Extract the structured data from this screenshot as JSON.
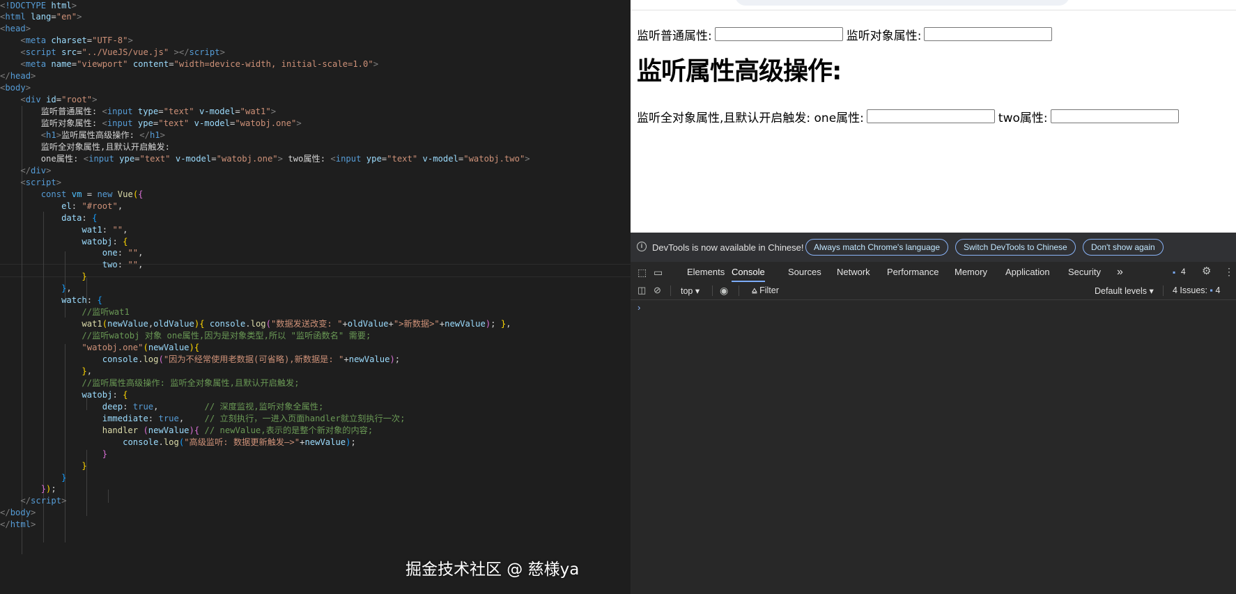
{
  "editor": {
    "lines": [
      [
        [
          "t-ang",
          "<"
        ],
        [
          "t-tag",
          "!DOCTYPE "
        ],
        [
          "t-attr",
          "html"
        ],
        [
          "t-ang",
          ">"
        ]
      ],
      [
        [
          "t-ang",
          "<"
        ],
        [
          "t-tag",
          "html "
        ],
        [
          "t-attr",
          "lang"
        ],
        [
          "t-pun",
          "="
        ],
        [
          "t-str",
          "\"en\""
        ],
        [
          "t-ang",
          ">"
        ]
      ],
      [
        [
          "t-ang",
          "<"
        ],
        [
          "t-tag",
          "head"
        ],
        [
          "t-ang",
          ">"
        ]
      ],
      [
        [
          "t-txt",
          "    "
        ],
        [
          "t-ang",
          "<"
        ],
        [
          "t-tag",
          "meta "
        ],
        [
          "t-attr",
          "charset"
        ],
        [
          "t-pun",
          "="
        ],
        [
          "t-str",
          "\"UTF-8\""
        ],
        [
          "t-ang",
          ">"
        ]
      ],
      [
        [
          "t-txt",
          "    "
        ],
        [
          "t-ang",
          "<"
        ],
        [
          "t-tag",
          "script "
        ],
        [
          "t-attr",
          "src"
        ],
        [
          "t-pun",
          "="
        ],
        [
          "t-str",
          "\"../VueJS/vue.js\""
        ],
        [
          "t-txt",
          " "
        ],
        [
          "t-ang",
          "></"
        ],
        [
          "t-tag",
          "script"
        ],
        [
          "t-ang",
          ">"
        ]
      ],
      [
        [
          "t-txt",
          "    "
        ],
        [
          "t-ang",
          "<"
        ],
        [
          "t-tag",
          "meta "
        ],
        [
          "t-attr",
          "name"
        ],
        [
          "t-pun",
          "="
        ],
        [
          "t-str",
          "\"viewport\""
        ],
        [
          "t-txt",
          " "
        ],
        [
          "t-attr",
          "content"
        ],
        [
          "t-pun",
          "="
        ],
        [
          "t-str",
          "\"width=device-width, initial-scale=1.0\""
        ],
        [
          "t-ang",
          ">"
        ]
      ],
      [
        [
          "t-ang",
          "</"
        ],
        [
          "t-tag",
          "head"
        ],
        [
          "t-ang",
          ">"
        ]
      ],
      [
        [
          "t-ang",
          "<"
        ],
        [
          "t-tag",
          "body"
        ],
        [
          "t-ang",
          ">"
        ]
      ],
      [
        [
          "t-txt",
          "    "
        ],
        [
          "t-ang",
          "<"
        ],
        [
          "t-tag",
          "div "
        ],
        [
          "t-attr",
          "id"
        ],
        [
          "t-pun",
          "="
        ],
        [
          "t-str",
          "\"root\""
        ],
        [
          "t-ang",
          ">"
        ]
      ],
      [
        [
          "t-txt",
          "        监听普通属性: "
        ],
        [
          "t-ang",
          "<"
        ],
        [
          "t-tag",
          "input "
        ],
        [
          "t-attr",
          "type"
        ],
        [
          "t-pun",
          "="
        ],
        [
          "t-str",
          "\"text\""
        ],
        [
          "t-txt",
          " "
        ],
        [
          "t-attr",
          "v-model"
        ],
        [
          "t-pun",
          "="
        ],
        [
          "t-str",
          "\"wat1\""
        ],
        [
          "t-ang",
          ">"
        ]
      ],
      [
        [
          "t-txt",
          "        监听对象属性: "
        ],
        [
          "t-ang",
          "<"
        ],
        [
          "t-tag",
          "input "
        ],
        [
          "t-attr",
          "ype"
        ],
        [
          "t-pun",
          "="
        ],
        [
          "t-str",
          "\"text\""
        ],
        [
          "t-txt",
          " "
        ],
        [
          "t-attr",
          "v-model"
        ],
        [
          "t-pun",
          "="
        ],
        [
          "t-str",
          "\"watobj.one\""
        ],
        [
          "t-ang",
          ">"
        ]
      ],
      [
        [
          "t-txt",
          "        "
        ],
        [
          "t-ang",
          "<"
        ],
        [
          "t-tag",
          "h1"
        ],
        [
          "t-ang",
          ">"
        ],
        [
          "t-txt",
          "监听属性高级操作: "
        ],
        [
          "t-ang",
          "</"
        ],
        [
          "t-tag",
          "h1"
        ],
        [
          "t-ang",
          ">"
        ]
      ],
      [
        [
          "t-txt",
          "        监听全对象属性,且默认开启触发:"
        ]
      ],
      [
        [
          "t-txt",
          "        one属性: "
        ],
        [
          "t-ang",
          "<"
        ],
        [
          "t-tag",
          "input "
        ],
        [
          "t-attr",
          "ype"
        ],
        [
          "t-pun",
          "="
        ],
        [
          "t-str",
          "\"text\""
        ],
        [
          "t-txt",
          " "
        ],
        [
          "t-attr",
          "v-model"
        ],
        [
          "t-pun",
          "="
        ],
        [
          "t-str",
          "\"watobj.one\""
        ],
        [
          "t-ang",
          ">"
        ],
        [
          "t-txt",
          " two属性: "
        ],
        [
          "t-ang",
          "<"
        ],
        [
          "t-tag",
          "input "
        ],
        [
          "t-attr",
          "ype"
        ],
        [
          "t-pun",
          "="
        ],
        [
          "t-str",
          "\"text\""
        ],
        [
          "t-txt",
          " "
        ],
        [
          "t-attr",
          "v-model"
        ],
        [
          "t-pun",
          "="
        ],
        [
          "t-str",
          "\"watobj.two\""
        ],
        [
          "t-ang",
          ">"
        ]
      ],
      [
        [
          "t-txt",
          "    "
        ],
        [
          "t-ang",
          "</"
        ],
        [
          "t-tag",
          "div"
        ],
        [
          "t-ang",
          ">"
        ]
      ],
      [
        [
          "t-txt",
          "    "
        ],
        [
          "t-ang",
          "<"
        ],
        [
          "t-tag",
          "script"
        ],
        [
          "t-ang",
          ">"
        ]
      ],
      [
        [
          "t-txt",
          "        "
        ],
        [
          "t-kw",
          "const "
        ],
        [
          "t-var",
          "vm"
        ],
        [
          "t-pun",
          " = "
        ],
        [
          "t-kw",
          "new "
        ],
        [
          "t-func",
          "Vue"
        ],
        [
          "t-p1",
          "("
        ],
        [
          "t-p2",
          "{"
        ]
      ],
      [
        [
          "t-txt",
          "            "
        ],
        [
          "t-prop",
          "el"
        ],
        [
          "t-pun",
          ": "
        ],
        [
          "t-str",
          "\"#root\""
        ],
        [
          "t-pun",
          ","
        ]
      ],
      [
        [
          "t-txt",
          "            "
        ],
        [
          "t-prop",
          "data"
        ],
        [
          "t-pun",
          ": "
        ],
        [
          "t-p3",
          "{"
        ]
      ],
      [
        [
          "t-txt",
          "                "
        ],
        [
          "t-prop",
          "wat1"
        ],
        [
          "t-pun",
          ": "
        ],
        [
          "t-str",
          "\"\""
        ],
        [
          "t-pun",
          ","
        ]
      ],
      [
        [
          "t-txt",
          "                "
        ],
        [
          "t-prop",
          "watobj"
        ],
        [
          "t-pun",
          ": "
        ],
        [
          "t-p1",
          "{"
        ]
      ],
      [
        [
          "t-txt",
          "                    "
        ],
        [
          "t-prop",
          "one"
        ],
        [
          "t-pun",
          ": "
        ],
        [
          "t-str",
          "\"\""
        ],
        [
          "t-pun",
          ","
        ]
      ],
      [
        [
          "t-txt",
          "                    "
        ],
        [
          "t-prop",
          "two"
        ],
        [
          "t-pun",
          ": "
        ],
        [
          "t-str",
          "\"\""
        ],
        [
          "t-pun",
          ","
        ]
      ],
      [
        [
          "t-txt",
          "                "
        ],
        [
          "t-p1",
          "}"
        ]
      ],
      [
        [
          "t-txt",
          "            "
        ],
        [
          "t-p3",
          "}"
        ],
        [
          "t-pun",
          ","
        ]
      ],
      [
        [
          "t-txt",
          "            "
        ],
        [
          "t-prop",
          "watch"
        ],
        [
          "t-pun",
          ": "
        ],
        [
          "t-p3",
          "{"
        ]
      ],
      [
        [
          "t-txt",
          "                "
        ],
        [
          "t-cmt",
          "//监听wat1"
        ]
      ],
      [
        [
          "t-txt",
          "                "
        ],
        [
          "t-func",
          "wat1"
        ],
        [
          "t-p1",
          "("
        ],
        [
          "t-prop",
          "newValue"
        ],
        [
          "t-pun",
          ","
        ],
        [
          "t-prop",
          "oldValue"
        ],
        [
          "t-p1",
          ")"
        ],
        [
          "t-p1",
          "{"
        ],
        [
          "t-txt",
          " "
        ],
        [
          "t-prop",
          "console"
        ],
        [
          "t-pun",
          "."
        ],
        [
          "t-func",
          "log"
        ],
        [
          "t-p2",
          "("
        ],
        [
          "t-str",
          "\"数据发送改变: \""
        ],
        [
          "t-pun",
          "+"
        ],
        [
          "t-prop",
          "oldValue"
        ],
        [
          "t-pun",
          "+"
        ],
        [
          "t-str",
          "\">新数据>\""
        ],
        [
          "t-pun",
          "+"
        ],
        [
          "t-prop",
          "newValue"
        ],
        [
          "t-p2",
          ")"
        ],
        [
          "t-pun",
          "; "
        ],
        [
          "t-p1",
          "}"
        ],
        [
          "t-pun",
          ","
        ]
      ],
      [
        [
          "t-txt",
          "                "
        ],
        [
          "t-cmt",
          "//监听watobj 对象 one属性,因为是对象类型,所以 \"监听函数名\" 需要;"
        ]
      ],
      [
        [
          "t-txt",
          "                "
        ],
        [
          "t-str",
          "\"watobj.one\""
        ],
        [
          "t-p1",
          "("
        ],
        [
          "t-prop",
          "newValue"
        ],
        [
          "t-p1",
          ")"
        ],
        [
          "t-p1",
          "{"
        ]
      ],
      [
        [
          "t-txt",
          "                    "
        ],
        [
          "t-prop",
          "console"
        ],
        [
          "t-pun",
          "."
        ],
        [
          "t-func",
          "log"
        ],
        [
          "t-p2",
          "("
        ],
        [
          "t-str",
          "\"因为不经常使用老数据(可省略),新数据是: \""
        ],
        [
          "t-pun",
          "+"
        ],
        [
          "t-prop",
          "newValue"
        ],
        [
          "t-p2",
          ")"
        ],
        [
          "t-pun",
          ";"
        ]
      ],
      [
        [
          "t-txt",
          "                "
        ],
        [
          "t-p1",
          "}"
        ],
        [
          "t-pun",
          ","
        ]
      ],
      [
        [
          "t-txt",
          "                "
        ],
        [
          "t-cmt",
          "//监听属性高级操作: 监听全对象属性,且默认开启触发;"
        ]
      ],
      [
        [
          "t-txt",
          "                "
        ],
        [
          "t-prop",
          "watobj"
        ],
        [
          "t-pun",
          ": "
        ],
        [
          "t-p1",
          "{"
        ]
      ],
      [
        [
          "t-txt",
          "                    "
        ],
        [
          "t-prop",
          "deep"
        ],
        [
          "t-pun",
          ": "
        ],
        [
          "t-bool",
          "true"
        ],
        [
          "t-pun",
          ",         "
        ],
        [
          "t-cmt",
          "// 深度监视,监听对象全属性;"
        ]
      ],
      [
        [
          "t-txt",
          "                    "
        ],
        [
          "t-prop",
          "immediate"
        ],
        [
          "t-pun",
          ": "
        ],
        [
          "t-bool",
          "true"
        ],
        [
          "t-pun",
          ",    "
        ],
        [
          "t-cmt",
          "// 立刻执行，一进入页面handler就立刻执行一次;"
        ]
      ],
      [
        [
          "t-txt",
          "                    "
        ],
        [
          "t-func",
          "handler "
        ],
        [
          "t-p2",
          "("
        ],
        [
          "t-prop",
          "newValue"
        ],
        [
          "t-p2",
          ")"
        ],
        [
          "t-p2",
          "{"
        ],
        [
          "t-txt",
          " "
        ],
        [
          "t-cmt",
          "// newValue,表示的是整个新对象的内容;"
        ]
      ],
      [
        [
          "t-txt",
          "                        "
        ],
        [
          "t-prop",
          "console"
        ],
        [
          "t-pun",
          "."
        ],
        [
          "t-func",
          "log"
        ],
        [
          "t-p3",
          "("
        ],
        [
          "t-str",
          "\"高级监听: 数据更新触发—>\""
        ],
        [
          "t-pun",
          "+"
        ],
        [
          "t-prop",
          "newValue"
        ],
        [
          "t-p3",
          ")"
        ],
        [
          "t-pun",
          ";"
        ]
      ],
      [
        [
          "t-txt",
          "                    "
        ],
        [
          "t-p2",
          "}"
        ]
      ],
      [
        [
          "t-txt",
          "                "
        ],
        [
          "t-p1",
          "}"
        ]
      ],
      [
        [
          "t-txt",
          "            "
        ],
        [
          "t-p3",
          "}"
        ]
      ],
      [
        [
          "t-txt",
          "        "
        ],
        [
          "t-p2",
          "}"
        ],
        [
          "t-p1",
          ")"
        ],
        [
          "t-pun",
          ";"
        ]
      ],
      [
        [
          "t-txt",
          "    "
        ],
        [
          "t-ang",
          "</"
        ],
        [
          "t-tag",
          "script"
        ],
        [
          "t-ang",
          ">"
        ]
      ],
      [
        [
          "t-ang",
          "</"
        ],
        [
          "t-tag",
          "body"
        ],
        [
          "t-ang",
          ">"
        ]
      ],
      [
        [
          "t-ang",
          "</"
        ],
        [
          "t-tag",
          "html"
        ],
        [
          "t-ang",
          ">"
        ]
      ]
    ]
  },
  "page": {
    "label_normal": "监听普通属性:",
    "label_object": "监听对象属性:",
    "heading": "监听属性高级操作:",
    "label_full": "监听全对象属性,且默认开启触发: one属性:",
    "label_two": "two属性:"
  },
  "devtools": {
    "banner_text": "DevTools is now available in Chinese!",
    "btn_match": "Always match Chrome's language",
    "btn_switch": "Switch DevTools to Chinese",
    "btn_dont": "Don't show again",
    "tabs": [
      "Elements",
      "Console",
      "Sources",
      "Network",
      "Performance",
      "Memory",
      "Application",
      "Security"
    ],
    "active_tab": "Console",
    "more_tabs": "»",
    "issues_badge": "4",
    "context": "top",
    "filter": "Filter",
    "levels": "Default levels",
    "issues_label": "4 Issues:",
    "issues_count": "4",
    "prompt": "›"
  },
  "watermark": "掘金技术社区 @ 慈様ya",
  "colors": {
    "editor_bg": "#1e1e1e",
    "devtools_bg": "#282828",
    "accent": "#7cacf8"
  }
}
